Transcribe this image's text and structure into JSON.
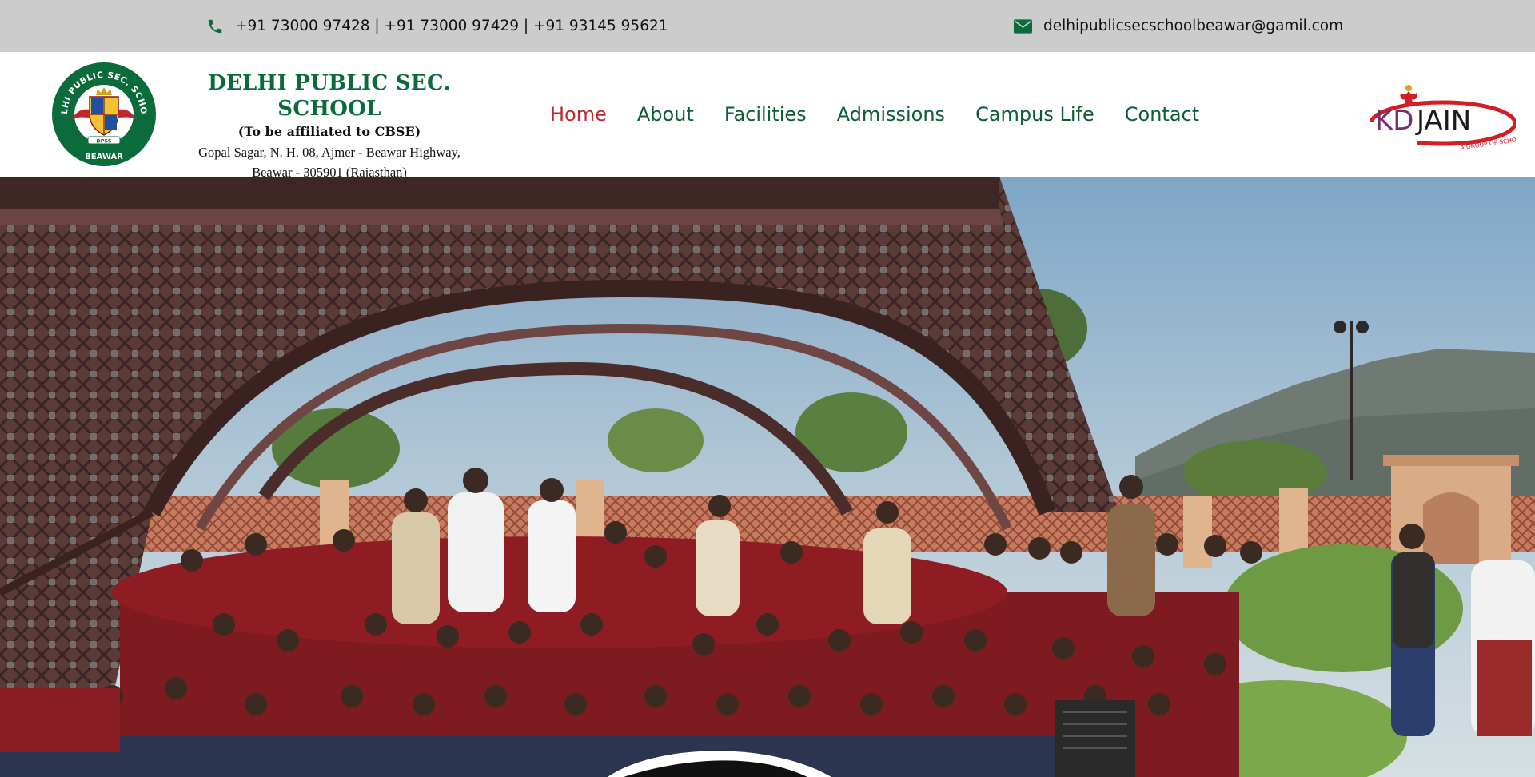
{
  "topbar": {
    "phone_icon": "phone-icon",
    "phones": "+91 73000 97428 | +91 73000 97429 | +91 93145 95621",
    "email_icon": "envelope-icon",
    "email": "delhipublicsecschoolbeawar@gamil.com"
  },
  "header": {
    "logo": {
      "ring_text": "DELHI PUBLIC SEC. SCHOOL",
      "bottom_text": "BEAWAR",
      "badge_text": "DPSS"
    },
    "school_name": "DELHI PUBLIC SEC. SCHOOL",
    "affiliation": "(To be affiliated to CBSE)",
    "address_line1": "Gopal Sagar, N. H. 08, Ajmer - Beawar Highway,",
    "address_line2": "Beawar - 305901 (Rajasthan)",
    "partner_logo": {
      "text_kd": "KD",
      "text_jain": "JAIN",
      "tagline": "A GROUP OF SCHOOL S'"
    }
  },
  "nav": {
    "items": [
      {
        "label": "Home",
        "active": true
      },
      {
        "label": "About",
        "active": false
      },
      {
        "label": "Facilities",
        "active": false
      },
      {
        "label": "Admissions",
        "active": false
      },
      {
        "label": "Campus Life",
        "active": false
      },
      {
        "label": "Contact",
        "active": false
      }
    ]
  },
  "hero": {
    "image": "group-photo-students-under-eiffel-tower-replica"
  },
  "colors": {
    "topbar_bg": "#cccccc",
    "brand_green": "#0b6b3a",
    "nav_green": "#0b5e34",
    "nav_active": "#c0272d",
    "uniform_maroon": "#8e1c22"
  }
}
